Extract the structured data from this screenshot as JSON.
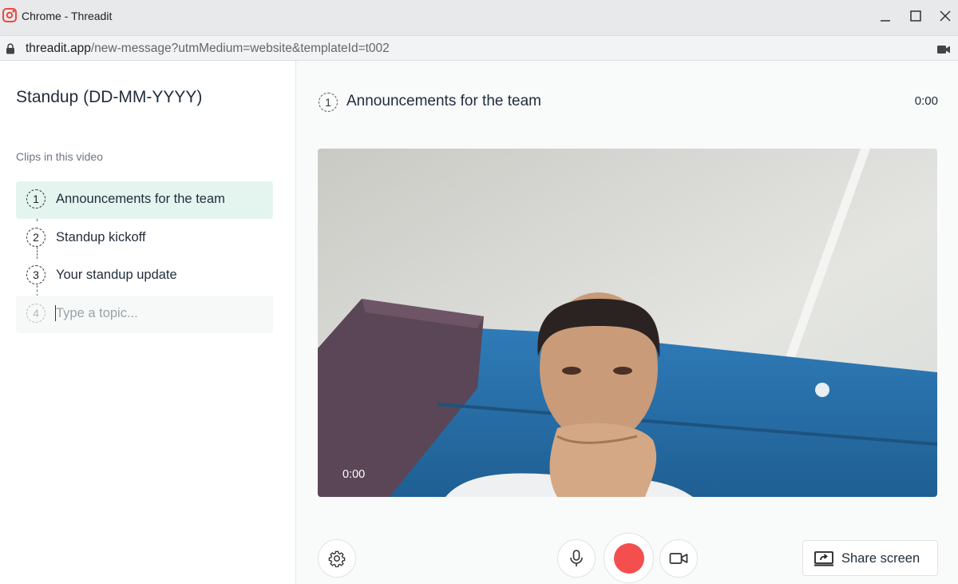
{
  "window": {
    "title": "Chrome - Threadit",
    "app_icon": "threadit-logo-icon",
    "controls": [
      "minimize-icon",
      "maximize-icon",
      "close-icon"
    ]
  },
  "address_bar": {
    "host": "threadit.app",
    "path": "/new-message?utmMedium=website&templateId=t002",
    "icons": [
      "lock-icon",
      "camera-in-use-icon"
    ]
  },
  "sidebar": {
    "title": "Standup (DD-MM-YYYY)",
    "clips_label": "Clips in this video",
    "clips": [
      {
        "number": "1",
        "label": "Announcements for the team",
        "active": true
      },
      {
        "number": "2",
        "label": "Standup kickoff"
      },
      {
        "number": "3",
        "label": "Your standup update"
      }
    ],
    "new_topic": {
      "number": "4",
      "placeholder": "Type a topic..."
    }
  },
  "main": {
    "clip_number": "1",
    "clip_title": "Announcements for the team",
    "timer": "0:00",
    "video": {
      "timer": "0:00",
      "content": "webcam-preview"
    }
  },
  "controls": {
    "settings_icon": "gear-icon",
    "mic_icon": "microphone-icon",
    "record_icon": "record-icon",
    "camera_icon": "video-camera-icon",
    "share_screen_label": "Share screen",
    "share_screen_icon": "share-screen-icon",
    "record_color": "#f54e4e"
  },
  "colors": {
    "active_clip_bg": "#e3f5ee",
    "wall_blue": "#2b74b0"
  }
}
